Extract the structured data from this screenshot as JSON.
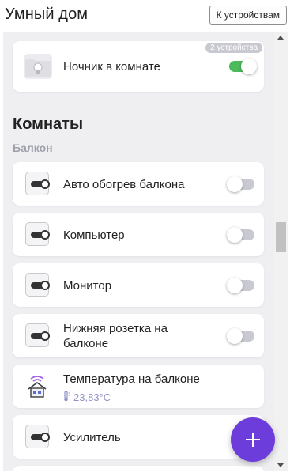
{
  "header": {
    "title": "Умный дом",
    "devices_button": "К устройствам"
  },
  "top_card": {
    "label": "Ночник в комнате",
    "badge": "2 устройства",
    "toggle_on": true
  },
  "rooms": {
    "section_title": "Комнаты",
    "room_name": "Балкон",
    "devices": [
      {
        "label": "Авто обогрев балкона",
        "icon": "socket-icon",
        "toggle_on": false
      },
      {
        "label": "Компьютер",
        "icon": "socket-icon",
        "toggle_on": false
      },
      {
        "label": "Монитор",
        "icon": "socket-icon",
        "toggle_on": false
      },
      {
        "label": "Нижняя розетка на балконе",
        "icon": "socket-icon",
        "toggle_on": false
      },
      {
        "label": "Температура на балконе",
        "icon": "home-sensor-icon",
        "value": "23,83°C"
      },
      {
        "label": "Усилитель",
        "icon": "socket-icon"
      }
    ]
  },
  "fab": {
    "icon": "plus-icon"
  },
  "colors": {
    "accent": "#6d3ddc",
    "toggle_on": "#4bba5a",
    "toggle_off": "#c9cad1",
    "background": "#efeff2",
    "room_label": "#9ea0aa",
    "sensor_value": "#8f93c6"
  }
}
